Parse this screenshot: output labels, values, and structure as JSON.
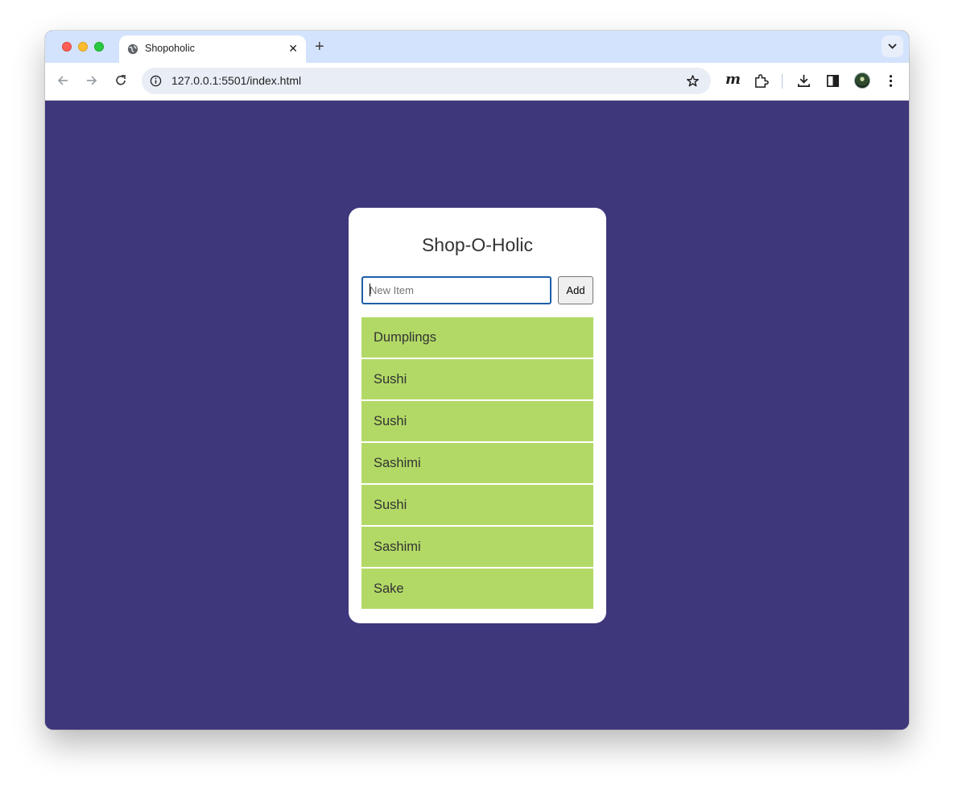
{
  "browser": {
    "tab_title": "Shopoholic",
    "tab_close_symbol": "✕",
    "new_tab_symbol": "+",
    "url": "127.0.0.1:5501/index.html",
    "extension_label": "m",
    "icons": [
      "back-icon",
      "forward-icon",
      "reload-icon",
      "info-icon",
      "star-icon",
      "puzzle-icon",
      "download-icon",
      "sidepanel-icon",
      "kebab-menu-icon",
      "globe-icon",
      "chevron-down-icon"
    ]
  },
  "app": {
    "title": "Shop-O-Holic",
    "input_placeholder": "New Item",
    "input_value": "",
    "add_label": "Add",
    "items": [
      {
        "label": "Dumplings"
      },
      {
        "label": "Sushi"
      },
      {
        "label": "Sushi"
      },
      {
        "label": "Sashimi"
      },
      {
        "label": "Sushi"
      },
      {
        "label": "Sashimi"
      },
      {
        "label": "Sake"
      }
    ]
  },
  "colors": {
    "page_background": "#3e377c",
    "card_background": "#ffffff",
    "item_background": "#b2d966",
    "input_focus_border": "#1f5ea8",
    "tabbar_background": "#d3e3fd"
  }
}
